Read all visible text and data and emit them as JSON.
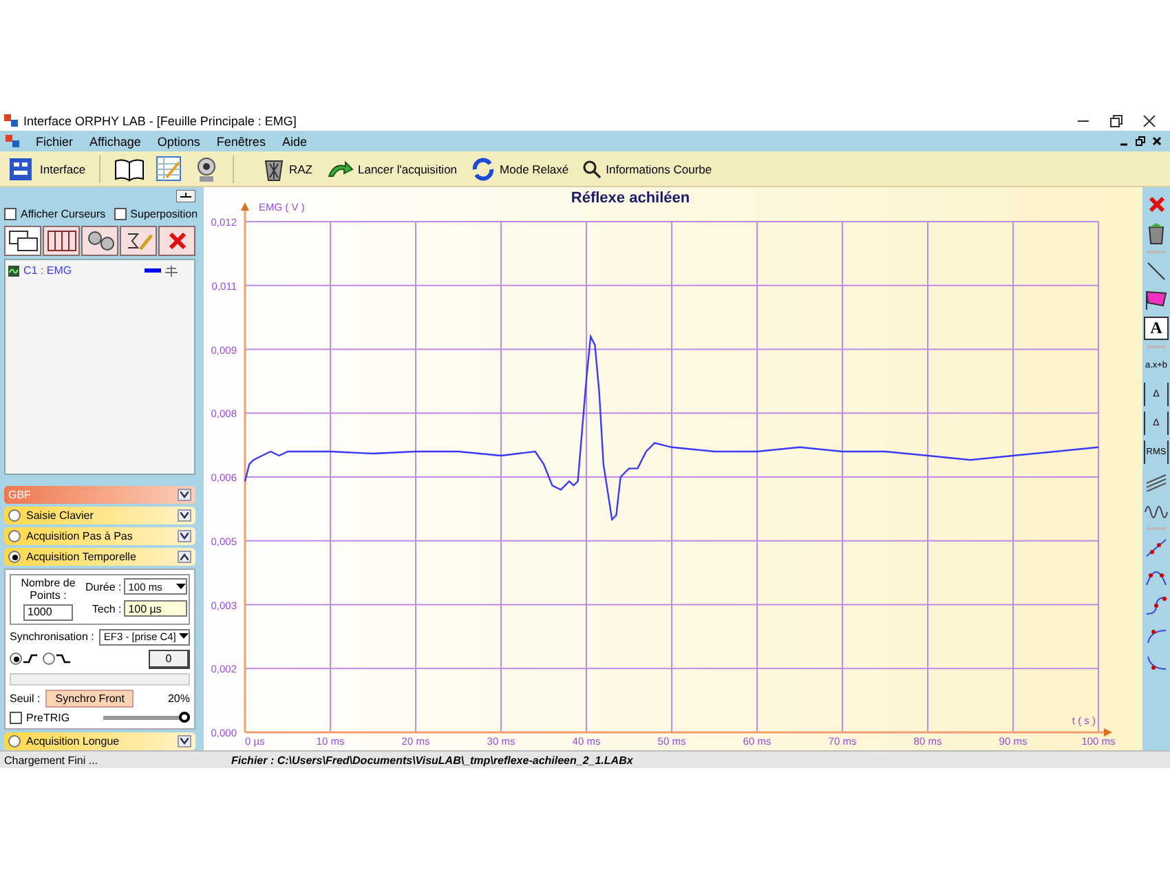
{
  "window": {
    "title": "Interface ORPHY LAB - [Feuille Principale :  EMG]"
  },
  "menu": [
    "Fichier",
    "Affichage",
    "Options",
    "Fenêtres",
    "Aide"
  ],
  "toolbar": {
    "left": [
      {
        "kind": "interface",
        "label": "Interface"
      },
      {
        "kind": "book"
      },
      {
        "kind": "notepad"
      },
      {
        "kind": "webcam"
      }
    ],
    "right": [
      {
        "kind": "trash",
        "label": "RAZ"
      },
      {
        "kind": "arrow",
        "label": "Lancer l'acquisition"
      },
      {
        "kind": "cycle",
        "label": "Mode Relaxé"
      },
      {
        "kind": "search",
        "label": "Informations Courbe"
      }
    ]
  },
  "left_panel": {
    "options": [
      {
        "label": "Afficher Curseurs",
        "checked": false
      },
      {
        "label": "Superposition",
        "checked": false
      }
    ],
    "tools": [
      {
        "kind": "windows"
      },
      {
        "kind": "columns"
      },
      {
        "kind": "gears"
      },
      {
        "kind": "formula"
      },
      {
        "kind": "delete"
      }
    ],
    "curves": [
      {
        "label": "C1 : EMG",
        "color": "#0000ff"
      }
    ]
  },
  "sections": [
    {
      "label": "GBF",
      "kind": "header",
      "expanded": false
    },
    {
      "label": "Saisie Clavier",
      "kind": "radio",
      "selected": false,
      "expanded": false
    },
    {
      "label": "Acquisition Pas à  Pas",
      "kind": "radio",
      "selected": false,
      "expanded": false
    },
    {
      "label": "Acquisition Temporelle",
      "kind": "radio",
      "selected": true,
      "expanded": true
    },
    {
      "label": "Acquisition Longue",
      "kind": "radio",
      "selected": false,
      "expanded": false
    }
  ],
  "acquisition": {
    "points_label": "Nombre de Points :",
    "points": "1000",
    "duree_label": "Durée :",
    "duree": "100 ms",
    "tech_label": "Tech :",
    "tech": "100 µs",
    "sync_label": "Synchronisation :",
    "sync": "EF3 - [prise C4]",
    "edges": [
      {
        "kind": "rising",
        "selected": true
      },
      {
        "kind": "falling",
        "selected": false
      }
    ],
    "counter": "0",
    "seuil_label": "Seuil :",
    "seuil": "Synchro Front",
    "percent": "20%",
    "pretrig": {
      "label": "PreTRIG",
      "checked": false
    },
    "pretrig_slider": {
      "level": 1
    }
  },
  "chart": {
    "chart_data": {
      "type": "line",
      "title": "Réflexe achiléen",
      "xlabel": "t ( s )",
      "ylabel": "EMG ( V )",
      "x": [
        0,
        0.5,
        1,
        2,
        3,
        4,
        5,
        6,
        8,
        10,
        15,
        20,
        25,
        30,
        32,
        34,
        35,
        36,
        37,
        38,
        38.5,
        39,
        40,
        40.5,
        41,
        41.5,
        42,
        43,
        43.5,
        44,
        45,
        46,
        47,
        48,
        50,
        55,
        60,
        65,
        70,
        75,
        80,
        85,
        90,
        95,
        100
      ],
      "grid": true,
      "series": [
        {
          "color": "#3a3aff",
          "values": [
            0.0059,
            0.0063,
            0.0064,
            0.0065,
            0.0066,
            0.0065,
            0.0066,
            0.0066,
            0.0066,
            0.0066,
            0.00655,
            0.0066,
            0.0066,
            0.0065,
            0.00655,
            0.0066,
            0.0063,
            0.0058,
            0.0057,
            0.0059,
            0.0058,
            0.0059,
            0.0083,
            0.0093,
            0.0091,
            0.008,
            0.0063,
            0.005,
            0.0051,
            0.006,
            0.0062,
            0.0062,
            0.0066,
            0.0068,
            0.0067,
            0.0066,
            0.0066,
            0.0067,
            0.0066,
            0.0066,
            0.0065,
            0.0064,
            0.0065,
            0.0066,
            0.0067
          ]
        }
      ],
      "xlim": [
        0,
        100
      ],
      "ylim": [
        0,
        0.012
      ],
      "xticks": [
        {
          "value": 0,
          "label": "0 µs"
        },
        {
          "value": 10,
          "label": "10 ms"
        },
        {
          "value": 20,
          "label": "20 ms"
        },
        {
          "value": 30,
          "label": "30 ms"
        },
        {
          "value": 40,
          "label": "40 ms"
        },
        {
          "value": 50,
          "label": "50 ms"
        },
        {
          "value": 60,
          "label": "60 ms"
        },
        {
          "value": 70,
          "label": "70 ms"
        },
        {
          "value": 80,
          "label": "80 ms"
        },
        {
          "value": 90,
          "label": "90 ms"
        },
        {
          "value": 100,
          "label": "100 ms"
        }
      ],
      "yticks": [
        {
          "value": 0,
          "label": "0,000"
        },
        {
          "value": 0.0015,
          "label": "0,002"
        },
        {
          "value": 0.003,
          "label": "0,003"
        },
        {
          "value": 0.0045,
          "label": "0,005"
        },
        {
          "value": 0.006,
          "label": "0,006"
        },
        {
          "value": 0.0075,
          "label": "0,008"
        },
        {
          "value": 0.009,
          "label": "0,009"
        },
        {
          "value": 0.0105,
          "label": "0,011"
        },
        {
          "value": 0.012,
          "label": "0,012"
        }
      ]
    }
  },
  "right_tools": [
    {
      "kind": "delete"
    },
    {
      "kind": "trash"
    },
    {
      "kind": "separator"
    },
    {
      "kind": "line"
    },
    {
      "kind": "flag"
    },
    {
      "kind": "text",
      "label": "A"
    },
    {
      "kind": "separator"
    },
    {
      "kind": "fit",
      "label": "a.x+b"
    },
    {
      "kind": "hmeasure",
      "label": "Δ"
    },
    {
      "kind": "vmeasure",
      "label": "Δ"
    },
    {
      "kind": "rms",
      "label": "RMS"
    },
    {
      "kind": "hatch"
    },
    {
      "kind": "wave"
    },
    {
      "kind": "separator"
    },
    {
      "kind": "linefit"
    },
    {
      "kind": "parabola"
    },
    {
      "kind": "scurve"
    },
    {
      "kind": "tangent"
    },
    {
      "kind": "tangent2"
    }
  ],
  "status_bar": {
    "message": "Chargement Fini ...",
    "file": "Fichier : C:\\Users\\Fred\\Documents\\VisuLAB\\_tmp\\reflexe-achileen_2_1.LABx"
  }
}
